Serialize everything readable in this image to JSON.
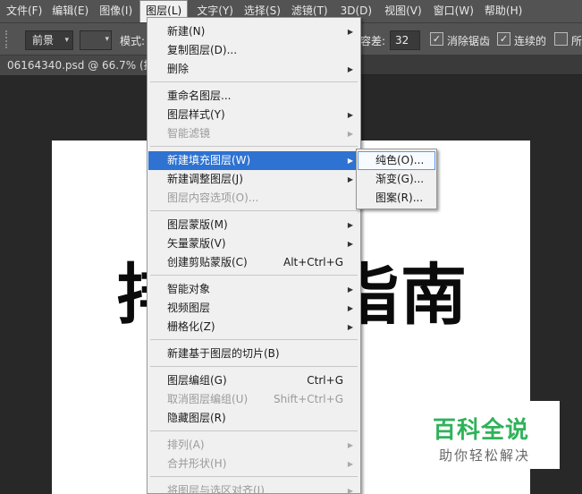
{
  "menubar": {
    "items": [
      "文件(F)",
      "编辑(E)",
      "图像(I)",
      "图层(L)",
      "文字(Y)",
      "选择(S)",
      "滤镜(T)",
      "3D(D)",
      "视图(V)",
      "窗口(W)",
      "帮助(H)"
    ]
  },
  "options_bar": {
    "preset_value": "前景",
    "mode_label": "模式:",
    "tolerance_label": "容差:",
    "tolerance_value": "32",
    "antialias_label": "消除锯齿",
    "contiguous_label": "连续的",
    "all_layers_label": "所"
  },
  "document": {
    "tab_title": "06164340.psd @ 66.7% (搜狗"
  },
  "canvas": {
    "text_left": "排",
    "text_right": "指南"
  },
  "layer_menu": {
    "items": [
      {
        "label": "新建(N)",
        "shortcut": "",
        "submenu": true
      },
      {
        "label": "复制图层(D)...",
        "shortcut": "",
        "submenu": false
      },
      {
        "label": "删除",
        "shortcut": "",
        "submenu": true
      },
      {
        "label": "重命名图层...",
        "shortcut": "",
        "submenu": false
      },
      {
        "label": "图层样式(Y)",
        "shortcut": "",
        "submenu": true
      },
      {
        "label": "智能滤镜",
        "shortcut": "",
        "submenu": true
      },
      {
        "label": "新建填充图层(W)",
        "shortcut": "",
        "submenu": true
      },
      {
        "label": "新建调整图层(J)",
        "shortcut": "",
        "submenu": true
      },
      {
        "label": "图层内容选项(O)...",
        "shortcut": "",
        "submenu": false
      },
      {
        "label": "图层蒙版(M)",
        "shortcut": "",
        "submenu": true
      },
      {
        "label": "矢量蒙版(V)",
        "shortcut": "",
        "submenu": true
      },
      {
        "label": "创建剪贴蒙版(C)",
        "shortcut": "Alt+Ctrl+G",
        "submenu": false
      },
      {
        "label": "智能对象",
        "shortcut": "",
        "submenu": true
      },
      {
        "label": "视频图层",
        "shortcut": "",
        "submenu": true
      },
      {
        "label": "栅格化(Z)",
        "shortcut": "",
        "submenu": true
      },
      {
        "label": "新建基于图层的切片(B)",
        "shortcut": "",
        "submenu": false
      },
      {
        "label": "图层编组(G)",
        "shortcut": "Ctrl+G",
        "submenu": false
      },
      {
        "label": "取消图层编组(U)",
        "shortcut": "Shift+Ctrl+G",
        "submenu": false
      },
      {
        "label": "隐藏图层(R)",
        "shortcut": "",
        "submenu": false
      },
      {
        "label": "排列(A)",
        "shortcut": "",
        "submenu": true
      },
      {
        "label": "合并形状(H)",
        "shortcut": "",
        "submenu": true
      },
      {
        "label": "将图层与选区对齐(I)",
        "shortcut": "",
        "submenu": true
      }
    ]
  },
  "fill_submenu": {
    "items": [
      "纯色(O)...",
      "渐变(G)...",
      "图案(R)..."
    ]
  },
  "watermark": {
    "title": "百科全说",
    "subtitle": "助你轻松解决"
  },
  "colors": {
    "menu_highlight": "#2e72d2",
    "watermark_green": "#2fb25a"
  }
}
